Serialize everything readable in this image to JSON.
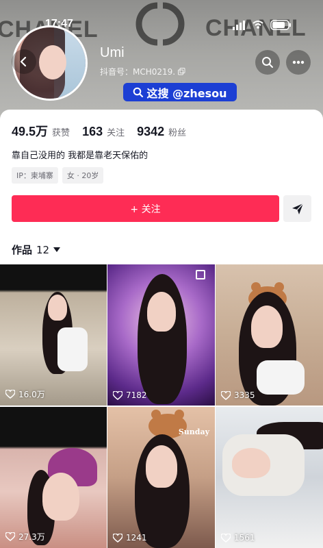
{
  "status_bar": {
    "time": "17:47"
  },
  "banner": {
    "watermark_left": "CHANEL",
    "watermark_right": "CHANEL"
  },
  "profile": {
    "username": "Umi",
    "douyin_id": "抖音号：MCH0219.",
    "promo": "这搜 @zhesou"
  },
  "stats": [
    {
      "value": "49.5万",
      "label": "获赞"
    },
    {
      "value": "163",
      "label": "关注"
    },
    {
      "value": "9342",
      "label": "粉丝"
    }
  ],
  "bio": "靠自己没用的 我都是靠老天保佑的",
  "tags": [
    "IP：柬埔寨",
    "女 · 20岁"
  ],
  "actions": {
    "follow_label": "+ 关注"
  },
  "works": {
    "label": "作品",
    "count": "12"
  },
  "videos": [
    {
      "likes": "16.0万"
    },
    {
      "likes": "7182"
    },
    {
      "likes": "3335"
    },
    {
      "likes": "27.3万"
    },
    {
      "likes": "1241"
    },
    {
      "likes": "1561"
    }
  ],
  "overlays": {
    "sunday_text": "Sunday"
  },
  "colors": {
    "accent": "#fe2c55",
    "promo_bg": "#1c3fd4"
  },
  "icons": [
    "back-icon",
    "search-icon",
    "more-icon",
    "copy-icon",
    "share-icon",
    "heart-icon",
    "dropdown-icon"
  ]
}
